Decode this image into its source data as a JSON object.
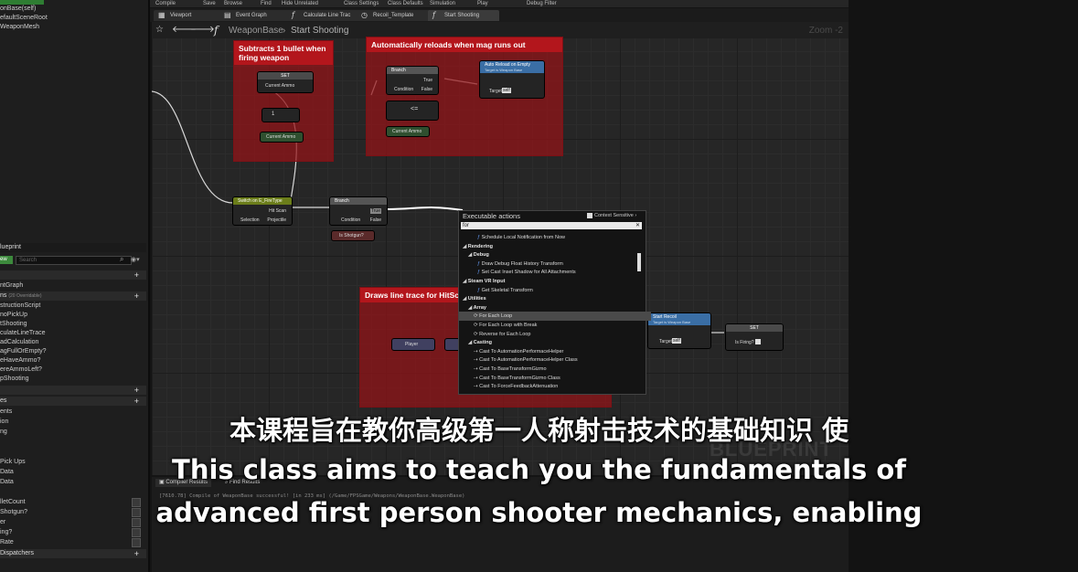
{
  "toolbar": {
    "items": [
      "Compile",
      "Save",
      "Browse",
      "Find",
      "Hide Unrelated",
      "Class Settings",
      "Class Defaults",
      "Simulation",
      "Play",
      "Debug Filter"
    ]
  },
  "tabs": [
    "Viewport",
    "Event Graph",
    "Calculate Line Trac",
    "Recoil_Template",
    "Start Shooting"
  ],
  "left_panel": {
    "components": [
      "onBase(self)",
      "efaultSceneRoot",
      "WeaponMesh"
    ],
    "my_blueprint_tab": "lueprint",
    "add_new": "ew",
    "search_placeholder": "Search",
    "graphs_header": "",
    "graph_item": "ntGraph",
    "functions_header": "ns",
    "functions_count": "(20 Overridable)",
    "functions": [
      "structionScript",
      "noPickUp",
      "tShooting",
      "culateLineTrace",
      "adCalculation",
      "agFullOrEmpty?",
      "eHaveAmmo?",
      "ereAmmoLeft?",
      "pShooting"
    ],
    "macros_header": "",
    "variables_header": "es",
    "variables": [
      "ents",
      "ion",
      "ng",
      "",
      "",
      "Pick Ups",
      "Data",
      "Data",
      "",
      "lletCount",
      "Shotgun?",
      "er",
      "ing?",
      "Rate"
    ],
    "dispatchers_header": "Dispatchers"
  },
  "breadcrumb": {
    "class": "WeaponBase",
    "function": "Start Shooting",
    "zoom": "Zoom -2"
  },
  "comments": [
    {
      "text": "Subtracts 1 bullet when firing weapon"
    },
    {
      "text": "Automatically reloads when mag runs out"
    },
    {
      "text": "Draws line trace for HitSca"
    }
  ],
  "nodes": {
    "set1": {
      "title": "SET",
      "pin": "Current Ammo"
    },
    "minus": {
      "title": "1"
    },
    "current_ammo1": {
      "title": "Current Ammo"
    },
    "branch1": {
      "title": "Branch",
      "condition": "Condition",
      "true": "True",
      "false": "False"
    },
    "compare": {
      "title": "<="
    },
    "current_ammo2": {
      "title": "Current Ammo"
    },
    "auto_reload": {
      "title": "Auto Reload on Empty",
      "subtitle": "Target is Weapon Base",
      "target": "Target",
      "self": "self"
    },
    "switch": {
      "title": "Switch on E_FireType",
      "selection": "Selection",
      "hitscan": "Hit Scan",
      "projectile": "Projectile"
    },
    "branch2": {
      "title": "Branch",
      "condition": "Condition",
      "true": "True",
      "false": "False"
    },
    "is_shotgun": {
      "title": "Is Shotgun?"
    },
    "start_recoil": {
      "title": "Start Recoil",
      "subtitle": "Target is Weapon Base",
      "target": "Target",
      "self": "self"
    },
    "set2": {
      "title": "SET",
      "pin": "Is Firing?"
    },
    "player": {
      "title": "Player"
    }
  },
  "context_menu": {
    "title": "Executable actions",
    "context_sensitive": "Context Sensitive",
    "search_value": "for",
    "rows": [
      {
        "text": "Schedule Local Notification from Now",
        "kind": "fn"
      },
      {
        "text": "Rendering",
        "kind": "cat"
      },
      {
        "text": "Debug",
        "kind": "cat2"
      },
      {
        "text": "Draw Debug Float History Transform",
        "kind": "fn"
      },
      {
        "text": "Set Cast Inset Shadow for All Attachments",
        "kind": "fn"
      },
      {
        "text": "Steam VR Input",
        "kind": "cat"
      },
      {
        "text": "Get Skeletal Transform",
        "kind": "fn"
      },
      {
        "text": "Utilities",
        "kind": "cat"
      },
      {
        "text": "Array",
        "kind": "cat2"
      },
      {
        "text": "For Each Loop",
        "kind": "loop"
      },
      {
        "text": "For Each Loop with Break",
        "kind": "loop"
      },
      {
        "text": "Reverse for Each Loop",
        "kind": "loop"
      },
      {
        "text": "Casting",
        "kind": "cat2"
      },
      {
        "text": "Cast To AutomationPerformaceHelper",
        "kind": "cast"
      },
      {
        "text": "Cast To AutomationPerformaceHelper Class",
        "kind": "cast"
      },
      {
        "text": "Cast To BaseTransformGizmo",
        "kind": "cast"
      },
      {
        "text": "Cast To BaseTransformGizmo Class",
        "kind": "cast"
      },
      {
        "text": "Cast To ForceFeedbackAttenuation",
        "kind": "cast"
      }
    ]
  },
  "compiler": {
    "tabs": [
      "Compiler Results",
      "Find Results"
    ],
    "log": "[7610.78] Compile of WeaponBase successful! [in 233 ms] (/Game/FPSGame/Weapons/WeaponBase.WeaponBase)"
  },
  "watermark": "BLUEPRINT",
  "subtitles": {
    "zh": "本课程旨在教你高级第一人称射击技术的基础知识 使",
    "en1": "This class aims to teach you the fundamentals of",
    "en2": "advanced first person shooter mechanics, enabling"
  },
  "colors": {
    "comment": "#b3161c",
    "graph_bg": "#262626",
    "exec_wire": "#ffffff"
  }
}
